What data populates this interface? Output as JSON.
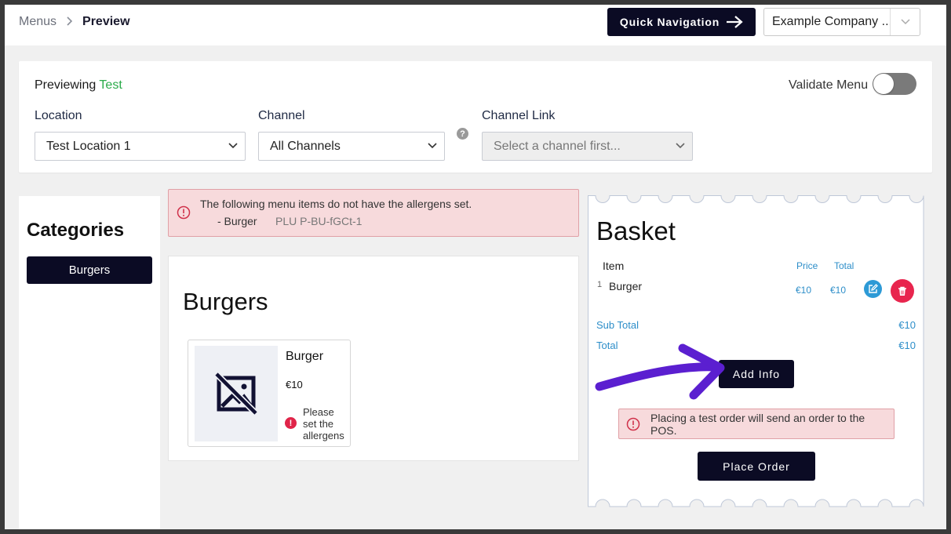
{
  "breadcrumb": {
    "items": [
      "Menus",
      "Preview"
    ]
  },
  "header": {
    "quick_nav_label": "Quick Navigation",
    "company_select_value": "Example Company ..."
  },
  "filters": {
    "previewing_label": "Previewing",
    "previewing_menu": "Test",
    "validate_label": "Validate Menu",
    "validate_on": false,
    "location_label": "Location",
    "location_value": "Test Location 1",
    "channel_label": "Channel",
    "channel_value": "All Channels",
    "help_glyph": "?",
    "channel_link_label": "Channel Link",
    "channel_link_placeholder": "Select a channel first..."
  },
  "categories": {
    "title": "Categories",
    "items": [
      "Burgers"
    ]
  },
  "allergen_warning": {
    "message": "The following menu items do not have the allergens set.",
    "item": "- Burger",
    "plu": "PLU P-BU-fGCt-1"
  },
  "menu": {
    "heading": "Burgers",
    "items": [
      {
        "name": "Burger",
        "price": "€10",
        "warning_glyph": "!",
        "warning": "Please set the allergens"
      }
    ]
  },
  "basket": {
    "title": "Basket",
    "col_item": "Item",
    "col_price": "Price",
    "col_total": "Total",
    "lines": [
      {
        "qty": "1",
        "name": "Burger",
        "price": "€10",
        "total": "€10"
      }
    ],
    "subtotal_label": "Sub Total",
    "subtotal_value": "€10",
    "total_label": "Total",
    "total_value": "€10",
    "add_info_label": "Add Info",
    "test_order_warning": "Placing a test order will send an order to the POS.",
    "place_order_label": "Place Order"
  },
  "colors": {
    "brand_dark": "#0b0b24",
    "accent_green": "#2bab4a",
    "link_blue": "#2d8ec9",
    "danger": "#e8254e",
    "annotation_purple": "#5b1fd0"
  }
}
